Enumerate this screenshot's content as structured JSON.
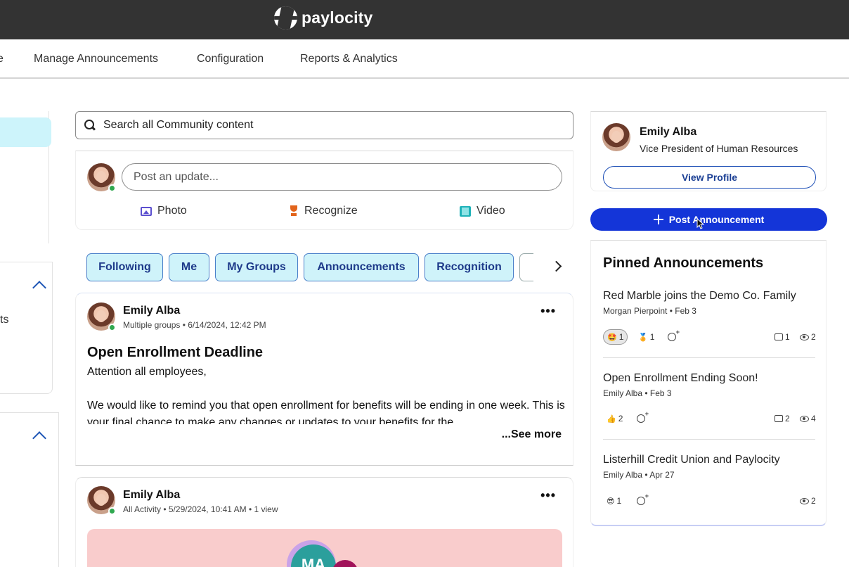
{
  "brand": {
    "name": "paylocity"
  },
  "nav": {
    "partial_item": "e",
    "items": [
      "Manage Announcements",
      "Configuration",
      "Reports & Analytics"
    ]
  },
  "left": {
    "partial_text": "ts"
  },
  "search": {
    "placeholder": "Search all Community content"
  },
  "composer": {
    "placeholder": "Post an update...",
    "actions": [
      {
        "label": "Photo",
        "icon": "photo-icon"
      },
      {
        "label": "Recognize",
        "icon": "trophy-icon"
      },
      {
        "label": "Video",
        "icon": "video-icon"
      }
    ]
  },
  "filters": [
    "Following",
    "Me",
    "My Groups",
    "Announcements",
    "Recognition"
  ],
  "posts": [
    {
      "author": "Emily Alba",
      "meta": "Multiple groups • 6/14/2024, 12:42 PM",
      "title": "Open Enrollment Deadline",
      "body": [
        "Attention all employees,",
        "",
        "We would like to remind you that open enrollment for benefits will be ending in one week. This is your final chance to make any changes or updates to your benefits for the"
      ],
      "see_more": "...See more"
    },
    {
      "author": "Emily Alba",
      "meta": "All Activity • 5/29/2024, 10:41 AM • 1 view",
      "banner_initials": "MA"
    }
  ],
  "profile": {
    "name": "Emily Alba",
    "title": "Vice President of Human Resources",
    "view_profile": "View Profile"
  },
  "post_announcement": "Post Announcement",
  "pinned": {
    "heading": "Pinned Announcements",
    "items": [
      {
        "title": "Red Marble joins the Demo Co. Family",
        "meta": "Morgan Pierpoint • Feb 3",
        "reactions": [
          {
            "emoji": "🤩",
            "count": "1",
            "active": true
          },
          {
            "emoji": "🏅",
            "count": "1",
            "active": false
          }
        ],
        "comments": "1",
        "views": "2"
      },
      {
        "title": "Open Enrollment Ending Soon!",
        "meta": "Emily Alba • Feb 3",
        "reactions": [
          {
            "emoji": "👍",
            "count": "2",
            "active": false
          }
        ],
        "comments": "2",
        "views": "4"
      },
      {
        "title": "Listerhill Credit Union and Paylocity",
        "meta": "Emily Alba • Apr 27",
        "reactions": [
          {
            "emoji": "😎",
            "count": "1",
            "active": false
          }
        ],
        "comments": null,
        "views": "2"
      }
    ]
  },
  "colors": {
    "topbar": "#333333",
    "accent": "#1435d8",
    "chip_bg": "#cff3fa",
    "online": "#2fa84f"
  }
}
